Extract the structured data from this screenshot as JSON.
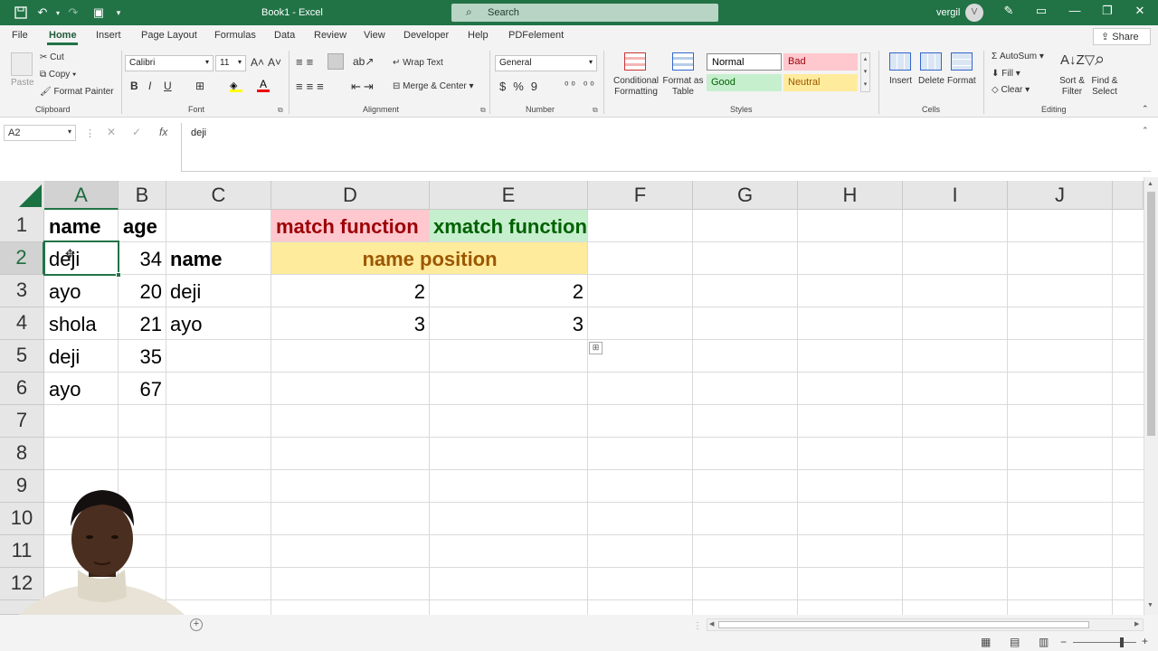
{
  "titlebar": {
    "title": "Book1  -  Excel",
    "search_placeholder": "Search",
    "user": "vergil",
    "avatar_initial": "V"
  },
  "tabs": [
    "File",
    "Home",
    "Insert",
    "Page Layout",
    "Formulas",
    "Data",
    "Review",
    "View",
    "Developer",
    "Help",
    "PDFelement"
  ],
  "share_label": "Share",
  "ribbon": {
    "clipboard": {
      "paste": "Paste",
      "cut": "Cut",
      "copy": "Copy",
      "format_painter": "Format Painter",
      "group": "Clipboard"
    },
    "font": {
      "name": "Calibri",
      "size": "11",
      "group": "Font"
    },
    "alignment": {
      "wrap": "Wrap Text",
      "merge": "Merge & Center",
      "group": "Alignment"
    },
    "number": {
      "format": "General",
      "group": "Number"
    },
    "styles": {
      "conditional": "Conditional Formatting",
      "format_table": "Format as Table",
      "normal": "Normal",
      "bad": "Bad",
      "good": "Good",
      "neutral": "Neutral",
      "group": "Styles"
    },
    "cells": {
      "insert": "Insert",
      "delete": "Delete",
      "format": "Format",
      "group": "Cells"
    },
    "editing": {
      "autosum": "AutoSum",
      "fill": "Fill",
      "clear": "Clear",
      "sort": "Sort & Filter",
      "find": "Find & Select",
      "group": "Editing"
    }
  },
  "formula_bar": {
    "name_box": "A2",
    "content": "deji"
  },
  "columns": [
    "A",
    "B",
    "C",
    "D",
    "E",
    "F",
    "G",
    "H",
    "I",
    "J"
  ],
  "rows": [
    "1",
    "2",
    "3",
    "4",
    "5",
    "6",
    "7",
    "8",
    "9",
    "10",
    "11",
    "12"
  ],
  "cells": {
    "A1": "name",
    "B1": "age",
    "D1": "match function",
    "E1": "xmatch function",
    "A2": "deji",
    "B2": "34",
    "C2": "name",
    "D2": "name position",
    "A3": "ayo",
    "B3": "20",
    "C3": "deji",
    "D3": "2",
    "E3": "2",
    "A4": "shola",
    "B4": "21",
    "C4": "ayo",
    "D4": "3",
    "E4": "3",
    "A5": "deji",
    "B5": "35",
    "A6": "ayo",
    "B6": "67"
  },
  "colors": {
    "accent": "#217346",
    "bad_fill": "#ffc7ce",
    "bad_text": "#9c0006",
    "good_fill": "#c6efce",
    "good_text": "#006100",
    "neutral_fill": "#ffeb9c",
    "neutral_text": "#9c5700"
  }
}
